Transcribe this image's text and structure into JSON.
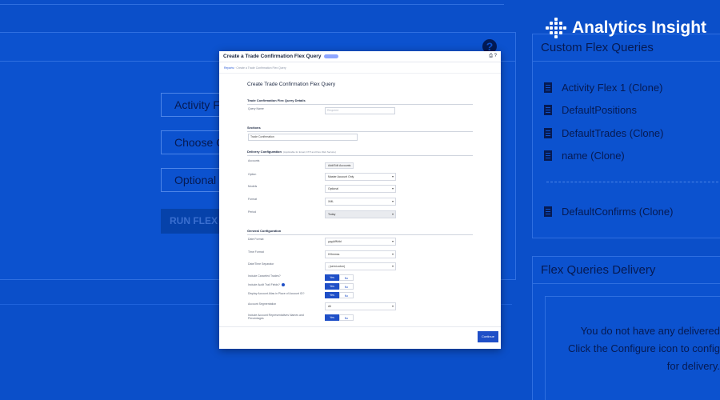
{
  "background": {
    "fields": [
      "Activity Flex",
      "Choose C",
      "Optional"
    ],
    "run_label": "RUN FLEX Q"
  },
  "brand": {
    "name": "Analytics Insight"
  },
  "custom_flex": {
    "title": "Custom Flex Queries",
    "items": [
      "Activity Flex 1 (Clone)",
      "DefaultPositions",
      "DefaultTrades (Clone)",
      "name (Clone)",
      "DefaultConfirms (Clone)"
    ]
  },
  "delivery": {
    "title": "Flex Queries Delivery",
    "lines": [
      "You do not have any delivered",
      "Click the Configure icon to config",
      "for delivery."
    ]
  },
  "modal": {
    "title": "Create a Trade Confirmation Flex Query",
    "breadcrumb_home": "Reports",
    "breadcrumb_current": "Create a Trade Confirmation Flex Query",
    "page_title": "Create Trade Confirmation Flex Query",
    "details_heading": "Trade Confirmation Flex Query Details",
    "query_name_label": "Query Name",
    "query_name_placeholder": "Required",
    "sections_heading": "Sections",
    "sections_value": "Trade Confirmation",
    "delivery_heading": "Delivery Configuration",
    "delivery_note": "(Applicable for Email, FTP and Flex Web Service)",
    "accounts_label": "Accounts",
    "accounts_button": "Add/Edit Accounts",
    "option_label": "Option",
    "option_value": "Master Account Only",
    "models_label": "Models",
    "models_value": "Optional",
    "format_label": "Format",
    "format_value": "XML",
    "period_label": "Period",
    "period_value": "Today",
    "general_heading": "General Configuration",
    "date_format_label": "Date Format",
    "date_format_value": "yyyyMMdd",
    "time_format_label": "Time Format",
    "time_format_value": "HHmmss",
    "separator_label": "Date/Time Separator",
    "separator_value": "; (semi-colon)",
    "canceled_label": "Include Canceled Trades?",
    "audit_label": "Include Audit Trail Fields?",
    "alias_label": "Display Account Alias in Place of Account ID?",
    "segmentation_label": "Account Segmentation",
    "segmentation_value": "All",
    "reps_label": "Include Account Representatives Names and Percentages",
    "yes_label": "Yes",
    "no_label": "No",
    "continue_label": "Continue"
  }
}
